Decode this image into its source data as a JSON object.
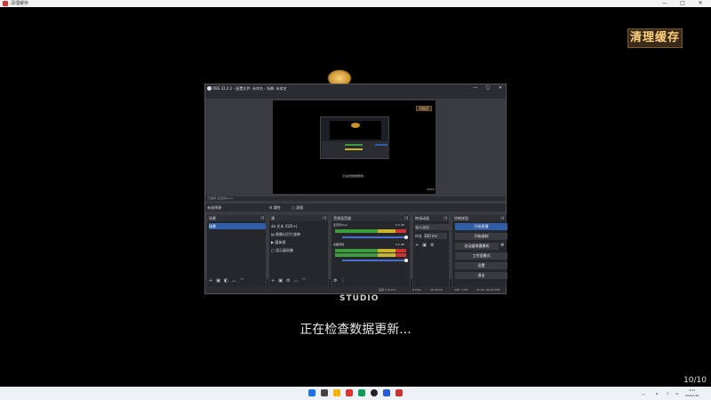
{
  "host_window": {
    "title": "清理缓存",
    "minimize": "—",
    "maximize": "□",
    "close": "✕"
  },
  "splash": {
    "cleanup_button": "清理缓存",
    "studio_text": "STUDIO",
    "status_message": "正在检查数据更新...",
    "page_counter": "10/10"
  },
  "obs": {
    "title": "OBS 31.0.2 - 配置文件: 未命名 - 场景: 未命名",
    "menu": [
      "文件(F)",
      "编辑(E)",
      "视图(V)",
      "停靠窗口(D)",
      "配置文件(P)",
      "场景集合(S)",
      "工具(T)",
      "帮助(H)"
    ],
    "preview_caption": "正在检查数据更新...",
    "nested_badge": "清理缓存",
    "nested_counter": "10/10",
    "mixer_label": "已静音 (麦克风/Aux)",
    "scene_bar_label": "未选择源",
    "scene_tabs": [
      "⚙ 属性",
      "▢ 滤镜"
    ],
    "scenes": {
      "header": "场景",
      "items": [
        "场景"
      ]
    },
    "sources": {
      "header": "源",
      "items": [
        "文本 (GDI+)",
        "图像幻灯片放映",
        "媒体源",
        "显示器采集"
      ]
    },
    "audio_mixer": {
      "header": "音频混音器",
      "tracks": [
        {
          "name": "麦克风/Aux",
          "level": "0.0 dB"
        },
        {
          "name": "桌面音频",
          "level": "0.0 dB"
        }
      ]
    },
    "transitions": {
      "header": "转场动画",
      "type": "淡入淡出",
      "duration_label": "时长",
      "duration": "300 ms"
    },
    "controls": {
      "header": "控制按钮",
      "buttons": [
        "开始直播",
        "开始录制",
        "启动虚拟摄像机",
        "工作室模式",
        "设置",
        "退出"
      ]
    },
    "status": {
      "frames": "丢帧 0 (0.0%)",
      "bitrate": "0 kbps",
      "rec": "00:00:00",
      "stream": "00:00:00",
      "cpu": "CPU: 1.0%",
      "fps": "60.00 / 60.00 FPS"
    }
  },
  "taskbar": {
    "time": "2:13",
    "date": "2025/1/20"
  }
}
